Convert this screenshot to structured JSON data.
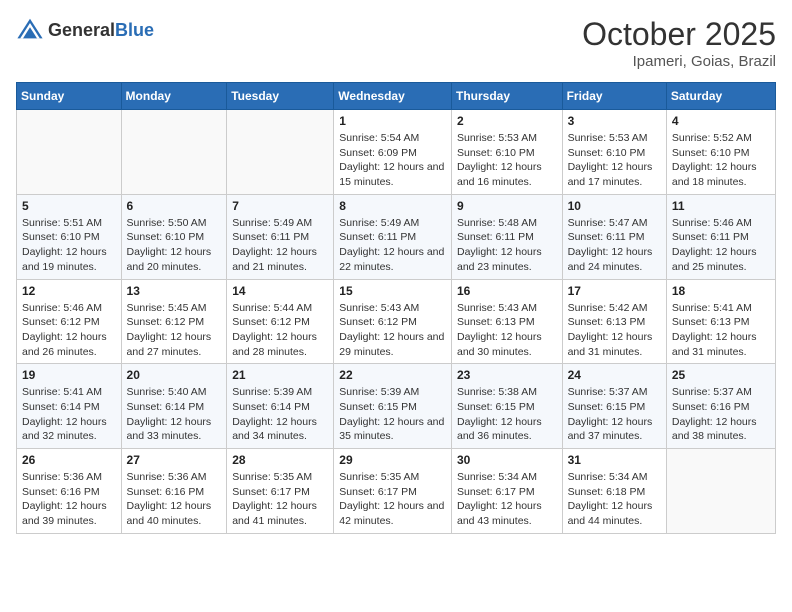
{
  "header": {
    "logo_general": "General",
    "logo_blue": "Blue",
    "month_year": "October 2025",
    "location": "Ipameri, Goias, Brazil"
  },
  "days_of_week": [
    "Sunday",
    "Monday",
    "Tuesday",
    "Wednesday",
    "Thursday",
    "Friday",
    "Saturday"
  ],
  "weeks": [
    [
      {
        "day": "",
        "info": ""
      },
      {
        "day": "",
        "info": ""
      },
      {
        "day": "",
        "info": ""
      },
      {
        "day": "1",
        "sunrise": "Sunrise: 5:54 AM",
        "sunset": "Sunset: 6:09 PM",
        "daylight": "Daylight: 12 hours and 15 minutes."
      },
      {
        "day": "2",
        "sunrise": "Sunrise: 5:53 AM",
        "sunset": "Sunset: 6:10 PM",
        "daylight": "Daylight: 12 hours and 16 minutes."
      },
      {
        "day": "3",
        "sunrise": "Sunrise: 5:53 AM",
        "sunset": "Sunset: 6:10 PM",
        "daylight": "Daylight: 12 hours and 17 minutes."
      },
      {
        "day": "4",
        "sunrise": "Sunrise: 5:52 AM",
        "sunset": "Sunset: 6:10 PM",
        "daylight": "Daylight: 12 hours and 18 minutes."
      }
    ],
    [
      {
        "day": "5",
        "sunrise": "Sunrise: 5:51 AM",
        "sunset": "Sunset: 6:10 PM",
        "daylight": "Daylight: 12 hours and 19 minutes."
      },
      {
        "day": "6",
        "sunrise": "Sunrise: 5:50 AM",
        "sunset": "Sunset: 6:10 PM",
        "daylight": "Daylight: 12 hours and 20 minutes."
      },
      {
        "day": "7",
        "sunrise": "Sunrise: 5:49 AM",
        "sunset": "Sunset: 6:11 PM",
        "daylight": "Daylight: 12 hours and 21 minutes."
      },
      {
        "day": "8",
        "sunrise": "Sunrise: 5:49 AM",
        "sunset": "Sunset: 6:11 PM",
        "daylight": "Daylight: 12 hours and 22 minutes."
      },
      {
        "day": "9",
        "sunrise": "Sunrise: 5:48 AM",
        "sunset": "Sunset: 6:11 PM",
        "daylight": "Daylight: 12 hours and 23 minutes."
      },
      {
        "day": "10",
        "sunrise": "Sunrise: 5:47 AM",
        "sunset": "Sunset: 6:11 PM",
        "daylight": "Daylight: 12 hours and 24 minutes."
      },
      {
        "day": "11",
        "sunrise": "Sunrise: 5:46 AM",
        "sunset": "Sunset: 6:11 PM",
        "daylight": "Daylight: 12 hours and 25 minutes."
      }
    ],
    [
      {
        "day": "12",
        "sunrise": "Sunrise: 5:46 AM",
        "sunset": "Sunset: 6:12 PM",
        "daylight": "Daylight: 12 hours and 26 minutes."
      },
      {
        "day": "13",
        "sunrise": "Sunrise: 5:45 AM",
        "sunset": "Sunset: 6:12 PM",
        "daylight": "Daylight: 12 hours and 27 minutes."
      },
      {
        "day": "14",
        "sunrise": "Sunrise: 5:44 AM",
        "sunset": "Sunset: 6:12 PM",
        "daylight": "Daylight: 12 hours and 28 minutes."
      },
      {
        "day": "15",
        "sunrise": "Sunrise: 5:43 AM",
        "sunset": "Sunset: 6:12 PM",
        "daylight": "Daylight: 12 hours and 29 minutes."
      },
      {
        "day": "16",
        "sunrise": "Sunrise: 5:43 AM",
        "sunset": "Sunset: 6:13 PM",
        "daylight": "Daylight: 12 hours and 30 minutes."
      },
      {
        "day": "17",
        "sunrise": "Sunrise: 5:42 AM",
        "sunset": "Sunset: 6:13 PM",
        "daylight": "Daylight: 12 hours and 31 minutes."
      },
      {
        "day": "18",
        "sunrise": "Sunrise: 5:41 AM",
        "sunset": "Sunset: 6:13 PM",
        "daylight": "Daylight: 12 hours and 31 minutes."
      }
    ],
    [
      {
        "day": "19",
        "sunrise": "Sunrise: 5:41 AM",
        "sunset": "Sunset: 6:14 PM",
        "daylight": "Daylight: 12 hours and 32 minutes."
      },
      {
        "day": "20",
        "sunrise": "Sunrise: 5:40 AM",
        "sunset": "Sunset: 6:14 PM",
        "daylight": "Daylight: 12 hours and 33 minutes."
      },
      {
        "day": "21",
        "sunrise": "Sunrise: 5:39 AM",
        "sunset": "Sunset: 6:14 PM",
        "daylight": "Daylight: 12 hours and 34 minutes."
      },
      {
        "day": "22",
        "sunrise": "Sunrise: 5:39 AM",
        "sunset": "Sunset: 6:15 PM",
        "daylight": "Daylight: 12 hours and 35 minutes."
      },
      {
        "day": "23",
        "sunrise": "Sunrise: 5:38 AM",
        "sunset": "Sunset: 6:15 PM",
        "daylight": "Daylight: 12 hours and 36 minutes."
      },
      {
        "day": "24",
        "sunrise": "Sunrise: 5:37 AM",
        "sunset": "Sunset: 6:15 PM",
        "daylight": "Daylight: 12 hours and 37 minutes."
      },
      {
        "day": "25",
        "sunrise": "Sunrise: 5:37 AM",
        "sunset": "Sunset: 6:16 PM",
        "daylight": "Daylight: 12 hours and 38 minutes."
      }
    ],
    [
      {
        "day": "26",
        "sunrise": "Sunrise: 5:36 AM",
        "sunset": "Sunset: 6:16 PM",
        "daylight": "Daylight: 12 hours and 39 minutes."
      },
      {
        "day": "27",
        "sunrise": "Sunrise: 5:36 AM",
        "sunset": "Sunset: 6:16 PM",
        "daylight": "Daylight: 12 hours and 40 minutes."
      },
      {
        "day": "28",
        "sunrise": "Sunrise: 5:35 AM",
        "sunset": "Sunset: 6:17 PM",
        "daylight": "Daylight: 12 hours and 41 minutes."
      },
      {
        "day": "29",
        "sunrise": "Sunrise: 5:35 AM",
        "sunset": "Sunset: 6:17 PM",
        "daylight": "Daylight: 12 hours and 42 minutes."
      },
      {
        "day": "30",
        "sunrise": "Sunrise: 5:34 AM",
        "sunset": "Sunset: 6:17 PM",
        "daylight": "Daylight: 12 hours and 43 minutes."
      },
      {
        "day": "31",
        "sunrise": "Sunrise: 5:34 AM",
        "sunset": "Sunset: 6:18 PM",
        "daylight": "Daylight: 12 hours and 44 minutes."
      },
      {
        "day": "",
        "info": ""
      }
    ]
  ]
}
